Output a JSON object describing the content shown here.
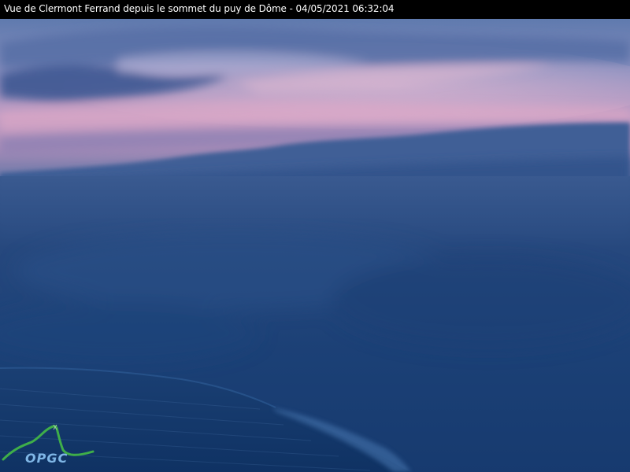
{
  "caption": {
    "text": "Vue de Clermont Ferrand depuis le sommet du puy de Dôme - 04/05/2021 06:32:04"
  },
  "logo": {
    "text": "OPGC",
    "colors": {
      "mountain": "#3fae49",
      "text": "#7fb6e6"
    }
  },
  "colors": {
    "caption_bar": "#000000",
    "caption_text": "#ffffff",
    "sky_top": "#6d86b5",
    "sky_pink": "#c79ec0",
    "mountain_ridge": "#3d5b92",
    "plain": "#1b4379",
    "foreground": "#123769"
  }
}
